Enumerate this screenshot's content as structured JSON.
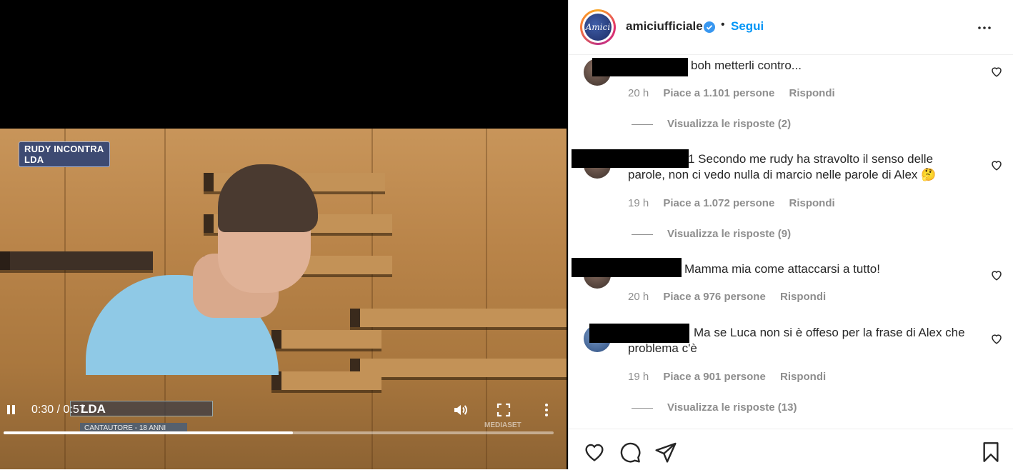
{
  "video": {
    "badge_line1": "RUDY INCONTRA",
    "badge_line2": "LDA",
    "lower_third_name": "LDA",
    "lower_third_sub": "CANTAUTORE - 18 ANNI",
    "watermark": "MEDIASET",
    "time": "0:30 / 0:57",
    "progress_fraction": 0.526
  },
  "header": {
    "username": "amiciufficiale",
    "separator": "•",
    "follow_label": "Segui"
  },
  "comments": [
    {
      "text": "boh metterli contro...",
      "time": "20 h",
      "likes": "Piace a 1.101 persone",
      "reply": "Rispondi",
      "view_replies": "Visualizza le risposte (2)"
    },
    {
      "text": "1 Secondo me rudy ha stravolto il senso delle parole, non ci vedo nulla di marcio nelle parole di Alex 🤔",
      "time": "19 h",
      "likes": "Piace a 1.072 persone",
      "reply": "Rispondi",
      "view_replies": "Visualizza le risposte (9)"
    },
    {
      "text": "Mamma mia come attaccarsi a tutto!",
      "time": "20 h",
      "likes": "Piace a 976 persone",
      "reply": "Rispondi"
    },
    {
      "text": "Ma se Luca non si è offeso per la frase di Alex che problema c'è",
      "time": "19 h",
      "likes": "Piace a 901 persone",
      "reply": "Rispondi",
      "view_replies": "Visualizza le risposte (13)"
    }
  ],
  "icons": {
    "like": "heart-icon",
    "comment": "comment-icon",
    "share": "share-icon",
    "save": "bookmark-icon",
    "verified": "verified-badge-icon",
    "more": "more-options-icon"
  },
  "colors": {
    "accent": "#0095f6",
    "verified": "#3897f0",
    "meta_text": "#8e8e8e"
  }
}
